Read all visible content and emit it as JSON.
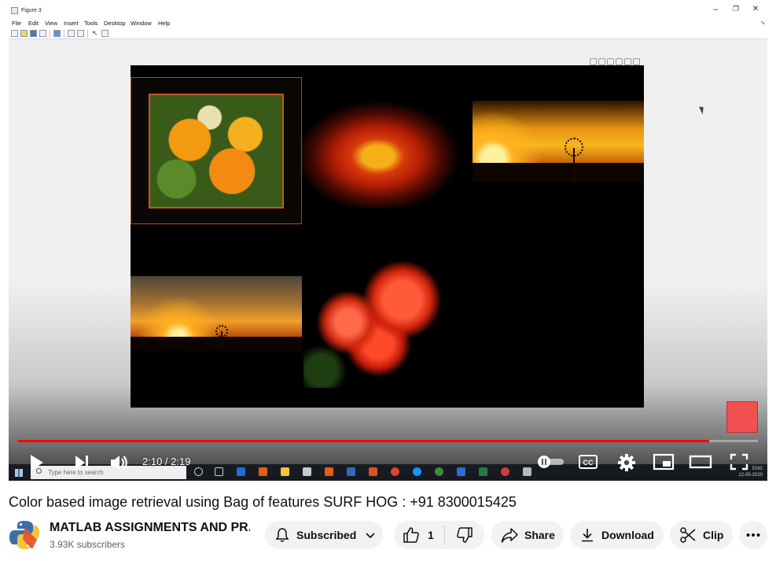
{
  "matlab": {
    "window_title": "Figure 3",
    "menus": [
      "File",
      "Edit",
      "View",
      "Insert",
      "Tools",
      "Desktop",
      "Window",
      "Help"
    ],
    "window_controls": [
      "–",
      "❐",
      "✕"
    ]
  },
  "player": {
    "time_display": "2:10 / 2:19",
    "progress_fraction": 0.934,
    "icons": [
      "play-icon",
      "next-icon",
      "volume-icon",
      "autoplay-toggle-icon",
      "cc-icon",
      "settings-icon",
      "miniplayer-icon",
      "theater-icon",
      "fullscreen-icon"
    ]
  },
  "taskbar": {
    "search_placeholder": "Type here to search",
    "tray_lang": "ENG",
    "tray_date": "12-05-2020"
  },
  "video": {
    "title": "Color based image retrieval using Bag of features SURF HOG : +91 8300015425"
  },
  "channel": {
    "name": "MATLAB ASSIGNMENTS AND PR...",
    "subscribers": "3.93K subscribers"
  },
  "actions": {
    "subscribed_label": "Subscribed",
    "like_count": "1",
    "share_label": "Share",
    "download_label": "Download",
    "clip_label": "Clip"
  },
  "colors": {
    "progress": "#ff0000",
    "pill_bg": "#f2f2f2",
    "text_primary": "#0f0f0f",
    "text_secondary": "#606060"
  }
}
